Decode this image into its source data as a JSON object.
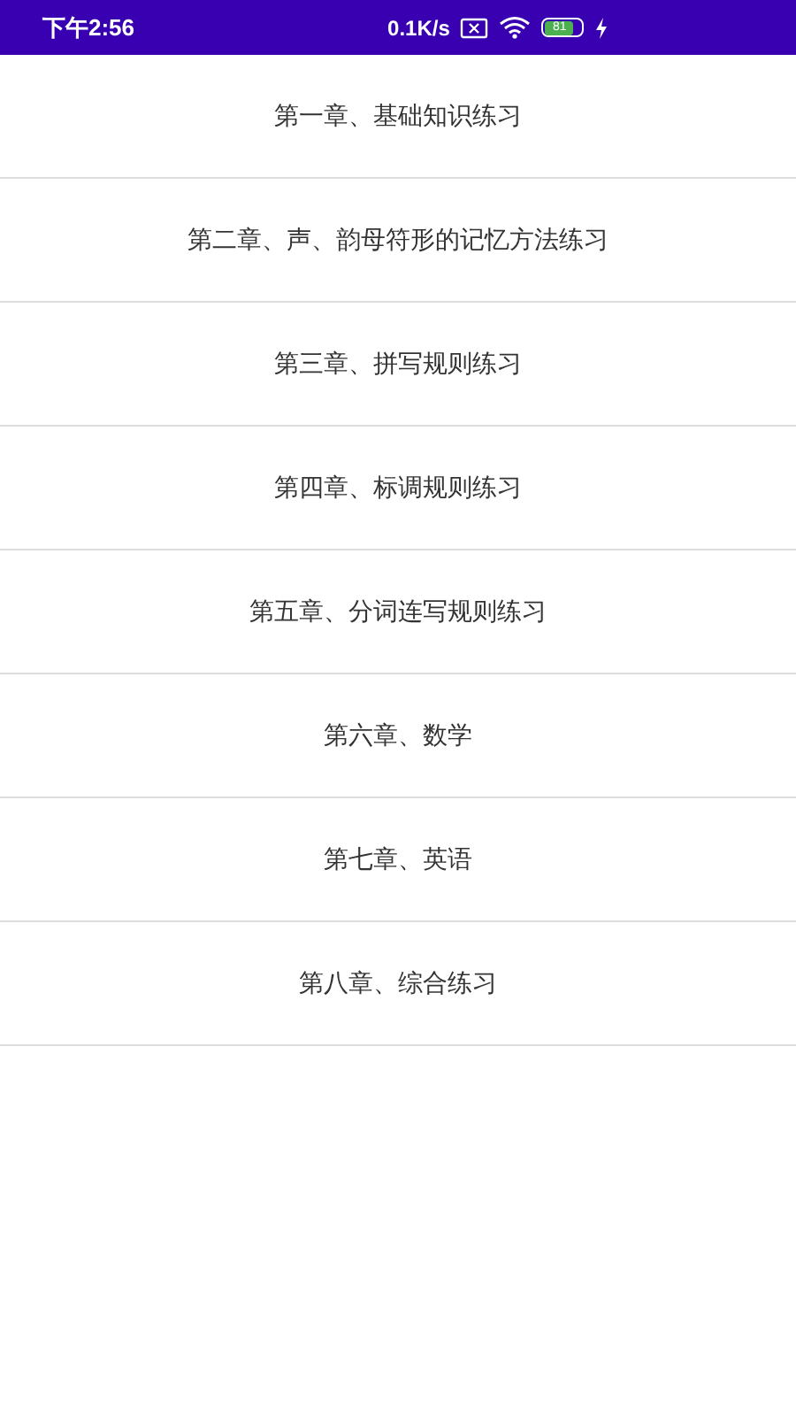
{
  "status_bar": {
    "time": "下午2:56",
    "net_speed": "0.1K/s",
    "battery": "81"
  },
  "chapters": [
    {
      "title": "第一章、基础知识练习"
    },
    {
      "title": "第二章、声、韵母符形的记忆方法练习"
    },
    {
      "title": "第三章、拼写规则练习"
    },
    {
      "title": "第四章、标调规则练习"
    },
    {
      "title": "第五章、分词连写规则练习"
    },
    {
      "title": "第六章、数学"
    },
    {
      "title": "第七章、英语"
    },
    {
      "title": "第八章、综合练习"
    }
  ]
}
